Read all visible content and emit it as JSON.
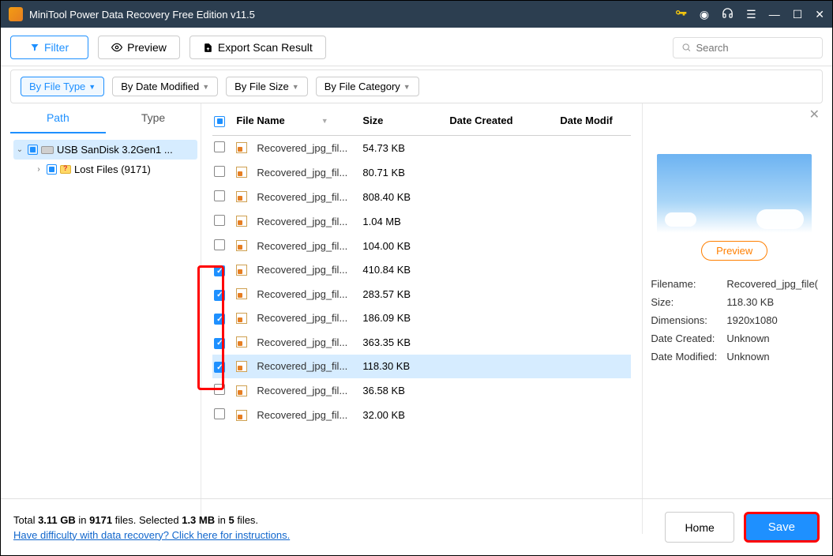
{
  "window": {
    "title": "MiniTool Power Data Recovery Free Edition v11.5"
  },
  "toolbar": {
    "filter": "Filter",
    "preview": "Preview",
    "export": "Export Scan Result",
    "search_placeholder": "Search"
  },
  "filters": {
    "file_type": "By File Type",
    "date_modified": "By Date Modified",
    "file_size": "By File Size",
    "file_category": "By File Category"
  },
  "sidebar": {
    "tabs": {
      "path": "Path",
      "type": "Type"
    },
    "drive": "USB SanDisk 3.2Gen1 ...",
    "lost_files": "Lost Files (9171)"
  },
  "columns": {
    "name": "File Name",
    "size": "Size",
    "created": "Date Created",
    "modified": "Date Modif"
  },
  "files": [
    {
      "name": "Recovered_jpg_fil...",
      "size": "54.73 KB",
      "checked": false
    },
    {
      "name": "Recovered_jpg_fil...",
      "size": "80.71 KB",
      "checked": false
    },
    {
      "name": "Recovered_jpg_fil...",
      "size": "808.40 KB",
      "checked": false
    },
    {
      "name": "Recovered_jpg_fil...",
      "size": "1.04 MB",
      "checked": false
    },
    {
      "name": "Recovered_jpg_fil...",
      "size": "104.00 KB",
      "checked": false
    },
    {
      "name": "Recovered_jpg_fil...",
      "size": "410.84 KB",
      "checked": true
    },
    {
      "name": "Recovered_jpg_fil...",
      "size": "283.57 KB",
      "checked": true
    },
    {
      "name": "Recovered_jpg_fil...",
      "size": "186.09 KB",
      "checked": true
    },
    {
      "name": "Recovered_jpg_fil...",
      "size": "363.35 KB",
      "checked": true
    },
    {
      "name": "Recovered_jpg_fil...",
      "size": "118.30 KB",
      "checked": true,
      "selected": true
    },
    {
      "name": "Recovered_jpg_fil...",
      "size": "36.58 KB",
      "checked": false
    },
    {
      "name": "Recovered_jpg_fil...",
      "size": "32.00 KB",
      "checked": false
    }
  ],
  "preview": {
    "button": "Preview",
    "filename_label": "Filename:",
    "filename_value": "Recovered_jpg_file(",
    "size_label": "Size:",
    "size_value": "118.30 KB",
    "dim_label": "Dimensions:",
    "dim_value": "1920x1080",
    "created_label": "Date Created:",
    "created_value": "Unknown",
    "modified_label": "Date Modified:",
    "modified_value": "Unknown"
  },
  "footer": {
    "total_prefix": "Total ",
    "total_size": "3.11 GB",
    "total_mid": " in ",
    "total_count": "9171",
    "total_suffix": " files.  ",
    "sel_prefix": "Selected ",
    "sel_size": "1.3 MB",
    "sel_mid": " in ",
    "sel_count": "5",
    "sel_suffix": " files.",
    "help_link": "Have difficulty with data recovery? Click here for instructions.",
    "home": "Home",
    "save": "Save"
  }
}
